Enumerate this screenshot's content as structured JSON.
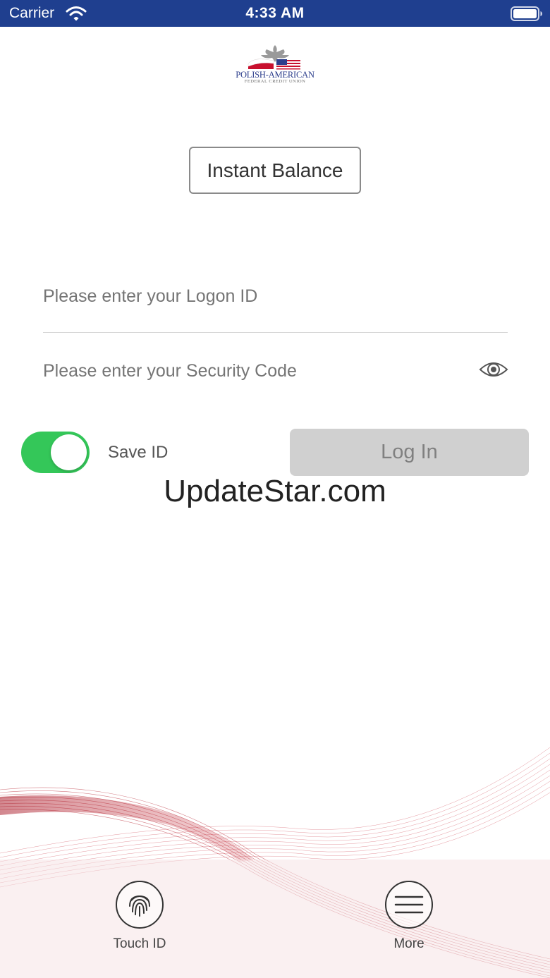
{
  "status_bar": {
    "carrier": "Carrier",
    "time": "4:33 AM"
  },
  "logo": {
    "name": "POLISH-AMERICAN",
    "subtitle": "FEDERAL CREDIT UNION"
  },
  "instant_balance": {
    "label": "Instant Balance"
  },
  "login_form": {
    "logon_id_placeholder": "Please enter your Logon ID",
    "logon_id_value": "",
    "security_code_placeholder": "Please enter your Security Code",
    "security_code_value": "",
    "save_id_label": "Save ID",
    "save_id_on": true,
    "login_label": "Log In"
  },
  "watermark": "UpdateStar.com",
  "tab_bar": {
    "items": [
      {
        "label": "Touch ID",
        "icon": "fingerprint-icon"
      },
      {
        "label": "More",
        "icon": "menu-icon"
      }
    ]
  },
  "colors": {
    "status_bar": "#1f3f8f",
    "toggle_on": "#34c759",
    "button_disabled": "#d0d0d0",
    "wave": "#b0121f"
  }
}
